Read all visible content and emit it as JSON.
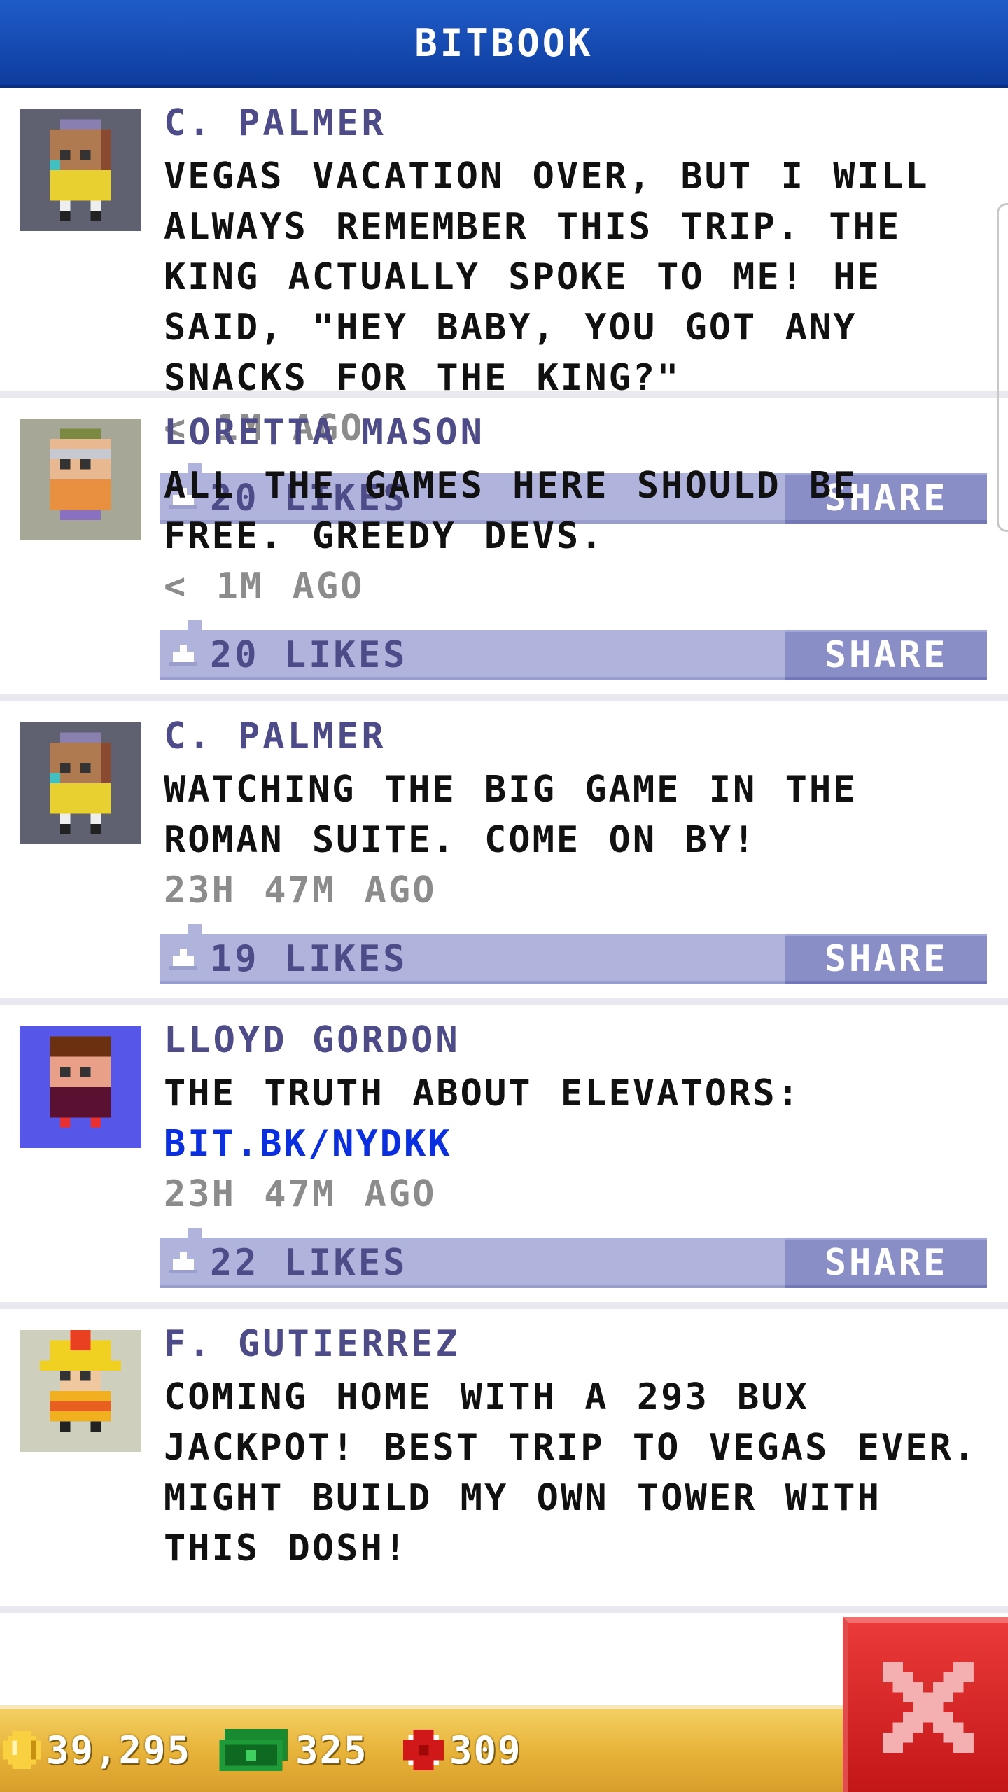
{
  "header": {
    "title": "BITBOOK"
  },
  "posts": [
    {
      "author": "C. PALMER",
      "message": "VEGAS VACATION OVER, BUT I WILL ALWAYS REMEMBER THIS TRIP. THE KING ACTUALLY SPOKE TO ME! HE SAID, \"HEY BABY, YOU GOT ANY SNACKS FOR THE KING?\"",
      "link": "",
      "time": "< 1M AGO",
      "likes": "20 LIKES",
      "share": "SHARE",
      "avatar_bg": "#5f6070"
    },
    {
      "author": "LORETTA MASON",
      "message": "ALL THE GAMES HERE SHOULD BE FREE. GREEDY DEVS.",
      "link": "",
      "time": "< 1M AGO",
      "likes": "20 LIKES",
      "share": "SHARE",
      "avatar_bg": "#a6a796"
    },
    {
      "author": "C. PALMER",
      "message": "WATCHING THE BIG GAME IN THE ROMAN SUITE. COME ON BY!",
      "link": "",
      "time": "23H 47M AGO",
      "likes": "19 LIKES",
      "share": "SHARE",
      "avatar_bg": "#5f6070"
    },
    {
      "author": "LLOYD GORDON",
      "message": "THE TRUTH ABOUT ELEVATORS:",
      "link": "BIT.BK/NYDKK",
      "time": "23H 47M AGO",
      "likes": "22 LIKES",
      "share": "SHARE",
      "avatar_bg": "#5656e8"
    },
    {
      "author": "F. GUTIERREZ",
      "message": "COMING HOME WITH A 293 BUX JACKPOT! BEST TRIP TO VEGAS EVER. MIGHT BUILD MY OWN TOWER WITH THIS DOSH!",
      "link": "",
      "time": "",
      "likes": "",
      "share": "",
      "avatar_bg": "#cfcfbd"
    }
  ],
  "status": {
    "coins": "39,295",
    "bux": "325",
    "tokens": "309"
  },
  "colors": {
    "header": "#1a4fb8",
    "author": "#4e4c88",
    "likebar": "#b0b4dc",
    "share_button": "#8a8ec6",
    "link": "#0a2fe0",
    "close_button": "#d42020",
    "statusbar": "#e8b43a"
  },
  "icons": {
    "like": "thumbs-up-icon",
    "coins": "coin-icon",
    "bux": "bux-bill-icon",
    "tokens": "token-icon",
    "close": "close-x-icon"
  }
}
